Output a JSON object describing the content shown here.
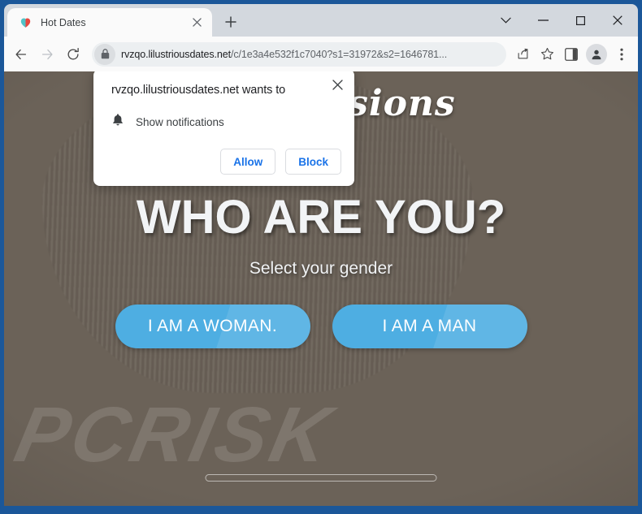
{
  "browser": {
    "tab": {
      "title": "Hot Dates",
      "favicon": "heart-icon",
      "close_label": "×"
    },
    "new_tab_label": "+",
    "window_controls": {
      "tab_search": "tab-search-icon",
      "minimize": "minimize-icon",
      "maximize": "maximize-icon",
      "close": "close-icon"
    },
    "toolbar": {
      "back": "back-arrow-icon",
      "forward": "forward-arrow-icon",
      "reload": "reload-icon",
      "lock": "lock-icon",
      "url_host": "rvzqo.lilustriousdates.net",
      "url_path": "/c/1e3a4e532f1c7040?s1=31972&s2=1646781...",
      "share": "share-icon",
      "bookmark": "star-icon",
      "side_panel": "side-panel-icon",
      "profile": "avatar-icon",
      "menu": "three-dot-menu-icon"
    }
  },
  "dialog": {
    "name": "notification-permission-dialog",
    "title": "rvzqo.lilustriousdates.net wants to",
    "permission_icon": "bell-icon",
    "permission_label": "Show notifications",
    "allow_label": "Allow",
    "block_label": "Block",
    "close_label": "×"
  },
  "page": {
    "logo_text": "Hot Passions",
    "heading": "WHO ARE YOU?",
    "subheading": "Select your gender",
    "choices": [
      {
        "label": "I AM A WOMAN."
      },
      {
        "label": "I AM A MAN"
      }
    ],
    "watermark": "PCRISK",
    "accent_color": "#4eaee2",
    "link_color": "#1a73e8",
    "frame_color": "#1b5799"
  }
}
